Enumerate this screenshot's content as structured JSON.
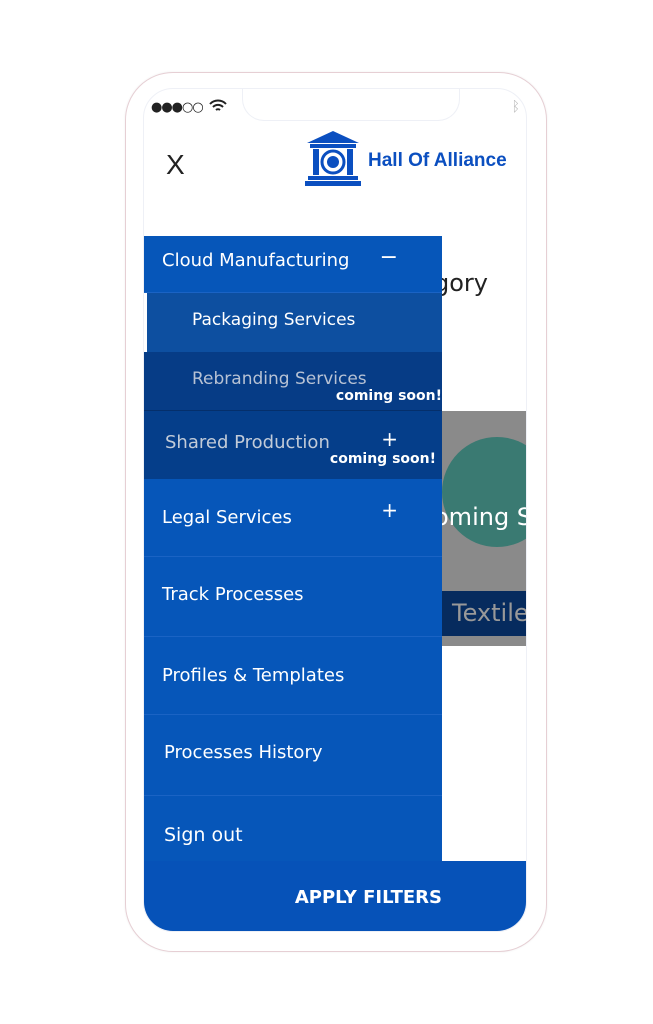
{
  "status": {
    "signal": "●●●○○",
    "wifi_icon": "wifi-icon",
    "bluetooth_icon": "bluetooth-icon"
  },
  "header": {
    "close_label": "X",
    "brand": "Hall Of Alliance"
  },
  "background": {
    "heading_fragment": "gory",
    "card_text": "oming S",
    "card_caption": "Textiles"
  },
  "menu": {
    "cloud": {
      "label": "Cloud Manufacturing",
      "toggle": "−"
    },
    "packaging": {
      "label": "Packaging Services"
    },
    "rebranding": {
      "label": "Rebranding Services",
      "badge": "coming soon!"
    },
    "shared": {
      "label": "Shared Production",
      "toggle": "+",
      "badge": "coming soon!"
    },
    "legal": {
      "label": "Legal Services",
      "toggle": "+"
    },
    "track": {
      "label": "Track Processes"
    },
    "profiles": {
      "label": "Profiles & Templates"
    },
    "history": {
      "label": "Processes History"
    },
    "signout": {
      "label": "Sign out"
    }
  },
  "footer": {
    "apply_label": "APPLY FILTERS"
  },
  "colors": {
    "primary": "#0656b9",
    "submenu": "#0d4fa0",
    "disabled": "#053e8a",
    "brand": "#0b4fc0"
  }
}
